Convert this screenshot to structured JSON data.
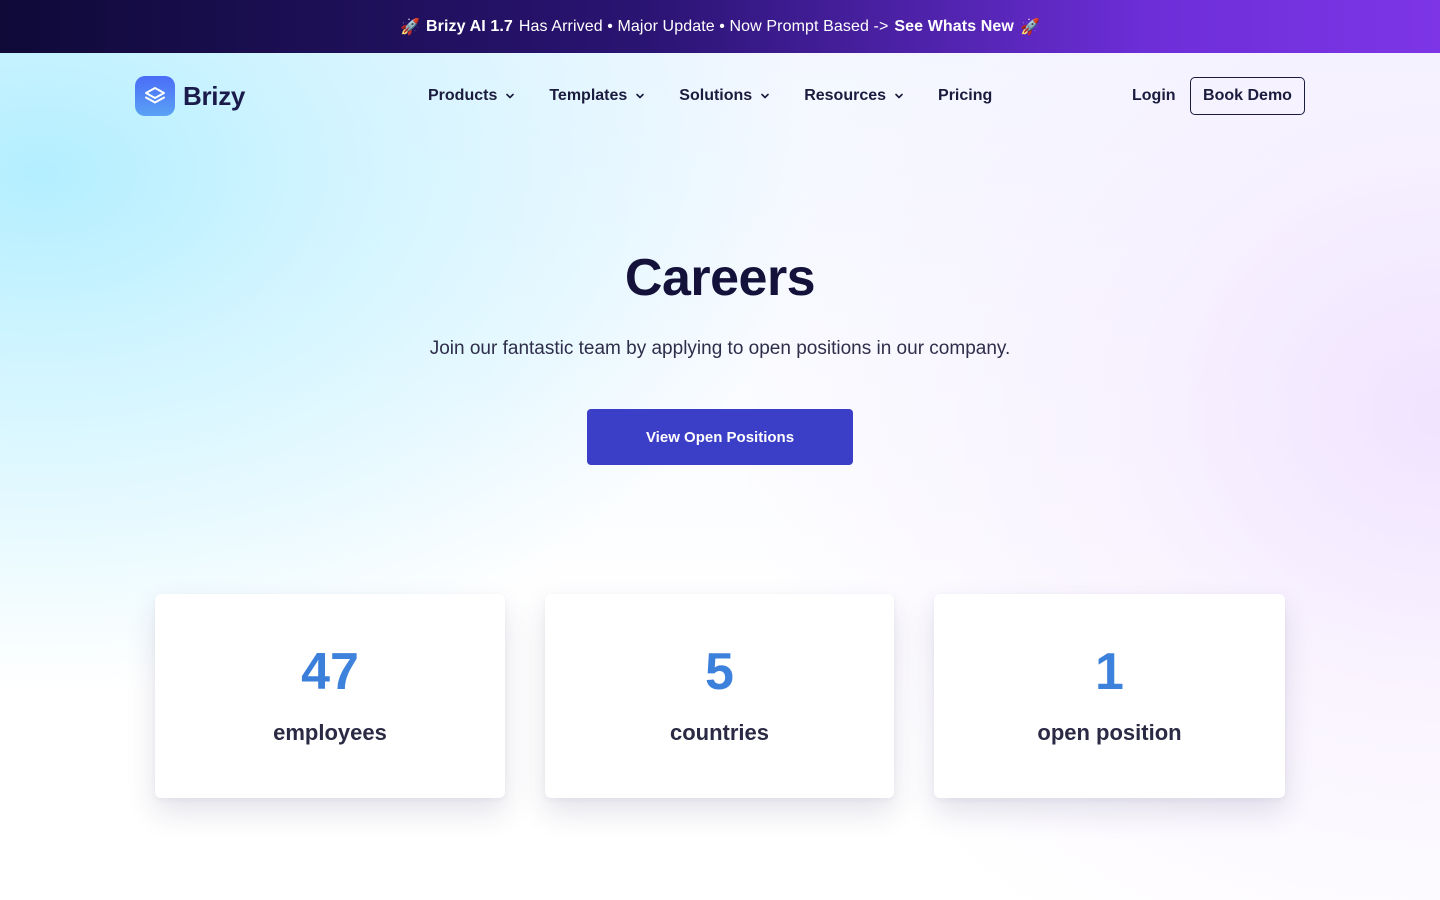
{
  "announcement": {
    "rocket_left": "🚀",
    "highlight": "Brizy AI 1.7",
    "text": "Has Arrived • Major Update • Now Prompt Based ->",
    "link": "See Whats New",
    "rocket_right": "🚀"
  },
  "nav": {
    "logo_text": "Brizy",
    "logo_icon": "layers-icon",
    "items": [
      {
        "label": "Products",
        "has_dropdown": true
      },
      {
        "label": "Templates",
        "has_dropdown": true
      },
      {
        "label": "Solutions",
        "has_dropdown": true
      },
      {
        "label": "Resources",
        "has_dropdown": true
      },
      {
        "label": "Pricing",
        "has_dropdown": false
      }
    ],
    "login": "Login",
    "book_demo": "Book Demo"
  },
  "hero": {
    "title": "Careers",
    "subtitle": "Join our fantastic team by applying to open positions in our company.",
    "cta": "View Open Positions"
  },
  "stats": [
    {
      "value": "47",
      "label": "employees"
    },
    {
      "value": "5",
      "label": "countries"
    },
    {
      "value": "1",
      "label": "open position"
    }
  ],
  "colors": {
    "cta": "#3b3ec6",
    "stat_number": "#3a7fd9",
    "heading": "#14123a"
  }
}
